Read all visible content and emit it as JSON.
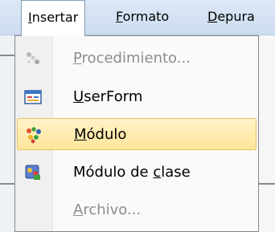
{
  "menubar": {
    "items": [
      {
        "pre": "",
        "acc": "I",
        "post": "nsertar"
      },
      {
        "pre": "",
        "acc": "F",
        "post": "ormato"
      },
      {
        "pre": "",
        "acc": "D",
        "post": "epura"
      }
    ]
  },
  "dropdown": {
    "items": [
      {
        "pre": "",
        "acc": "P",
        "post": "rocedimiento...",
        "enabled": false,
        "icon": "procedure-icon"
      },
      {
        "pre": "",
        "acc": "U",
        "post": "serForm",
        "enabled": true,
        "icon": "userform-icon"
      },
      {
        "pre": "",
        "acc": "M",
        "post": "ódulo",
        "enabled": true,
        "highlighted": true,
        "icon": "module-icon"
      },
      {
        "pre": "Módulo de ",
        "acc": "c",
        "post": "lase",
        "enabled": true,
        "icon": "class-module-icon"
      },
      {
        "pre": "",
        "acc": "A",
        "post": "rchivo...",
        "enabled": false,
        "icon": "file-icon"
      }
    ]
  },
  "colors": {
    "highlight_top": "#fff3c8",
    "highlight_bottom": "#ffe59a",
    "disabled_text": "#8d8d8d"
  }
}
